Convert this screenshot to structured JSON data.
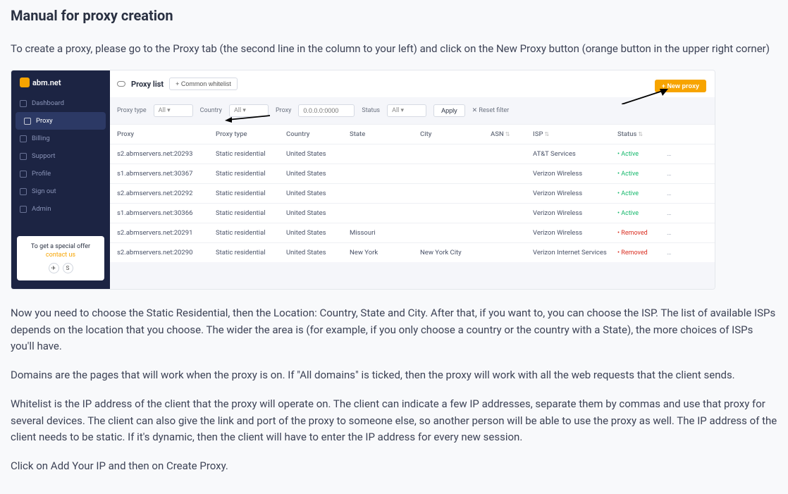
{
  "title": "Manual for proxy creation",
  "intro_text": "To create a proxy, please go to the Proxy tab (the second line in the column to your left) and click on the New Proxy button (orange button in the upper right corner)",
  "sidebar": {
    "brand": "abm.net",
    "nav": [
      {
        "label": "Dashboard"
      },
      {
        "label": "Proxy"
      },
      {
        "label": "Billing"
      },
      {
        "label": "Support"
      },
      {
        "label": "Profile"
      },
      {
        "label": "Sign out"
      },
      {
        "label": "Admin"
      }
    ],
    "promo_text": "To get a special offer",
    "promo_link": "contact us"
  },
  "toolbar": {
    "title": "Proxy list",
    "whitelist_btn": "+ Common whitelist",
    "new_proxy_btn": "+ New proxy"
  },
  "filters": {
    "proxy_type_label": "Proxy type",
    "proxy_type_value": "All",
    "country_label": "Country",
    "country_value": "All",
    "proxy_label": "Proxy",
    "proxy_placeholder": "0.0.0.0:0000",
    "status_label": "Status",
    "status_value": "All",
    "apply": "Apply",
    "reset": "✕ Reset filter"
  },
  "table": {
    "headers": {
      "proxy": "Proxy",
      "proxy_type": "Proxy type",
      "country": "Country",
      "state": "State",
      "city": "City",
      "asn": "ASN",
      "isp": "ISP",
      "status": "Status"
    },
    "rows": [
      {
        "proxy": "s2.abmservers.net:20293",
        "proxy_type": "Static residential",
        "country": "United States",
        "state": "",
        "city": "",
        "asn": "",
        "isp": "AT&T Services",
        "status": "Active",
        "statusType": "active"
      },
      {
        "proxy": "s1.abmservers.net:30367",
        "proxy_type": "Static residential",
        "country": "United States",
        "state": "",
        "city": "",
        "asn": "",
        "isp": "Verizon Wireless",
        "status": "Active",
        "statusType": "active"
      },
      {
        "proxy": "s2.abmservers.net:20292",
        "proxy_type": "Static residential",
        "country": "United States",
        "state": "",
        "city": "",
        "asn": "",
        "isp": "Verizon Wireless",
        "status": "Active",
        "statusType": "active"
      },
      {
        "proxy": "s1.abmservers.net:30366",
        "proxy_type": "Static residential",
        "country": "United States",
        "state": "",
        "city": "",
        "asn": "",
        "isp": "Verizon Wireless",
        "status": "Active",
        "statusType": "active"
      },
      {
        "proxy": "s2.abmservers.net:20291",
        "proxy_type": "Static residential",
        "country": "United States",
        "state": "Missouri",
        "city": "",
        "asn": "",
        "isp": "Verizon Wireless",
        "status": "Removed",
        "statusType": "removed"
      },
      {
        "proxy": "s2.abmservers.net:20290",
        "proxy_type": "Static residential",
        "country": "United States",
        "state": "New York",
        "city": "New York City",
        "asn": "",
        "isp": "Verizon Internet Services",
        "status": "Removed",
        "statusType": "removed"
      }
    ]
  },
  "paragraphs": {
    "p2": "Now you need to choose the Static Residential, then the Location: Country, State and City. After that, if you want to, you can choose the ISP. The list of available ISPs depends on the location that you choose. The wider the area is (for example, if you only choose a country or the country with a State), the more choices of ISPs you'll have.",
    "p3": "Domains are the pages that will work when the proxy is on. If \"All domains\" is ticked, then the proxy will work with all the web requests that the client sends.",
    "p4": "Whitelist is the IP address of the client that the proxy will operate on. The client can indicate a few IP addresses, separate them by commas and use that proxy for several devices. The client can also give the link and port of the proxy to someone else, so another person will be able to use the proxy as well. The IP address of the client needs to be static. If it's dynamic, then the client will have to enter the IP address for every new session.",
    "p5": "Click on Add Your IP and then on Create Proxy."
  }
}
